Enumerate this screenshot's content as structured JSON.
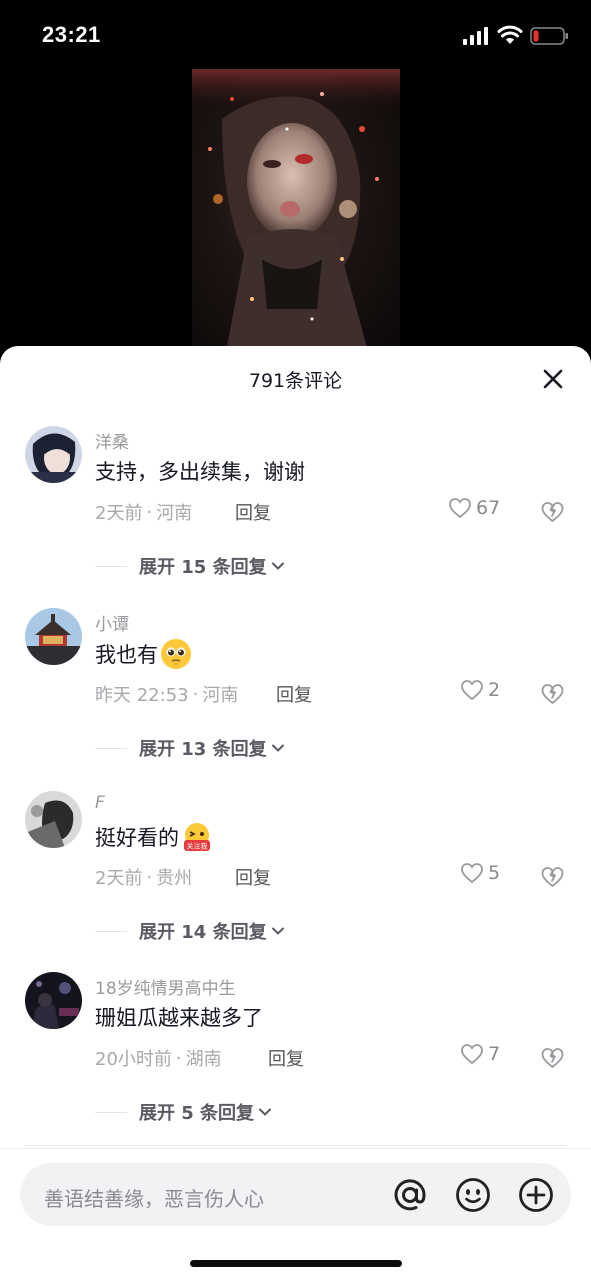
{
  "status_bar": {
    "time": "23:21",
    "battery_color": "#e5332a"
  },
  "sheet": {
    "title": "791条评论"
  },
  "comments": [
    {
      "username": "洋桑",
      "text": "支持，多出续集，谢谢",
      "emoji": "",
      "time": "2天前",
      "location": "河南",
      "reply_label": "回复",
      "likes": "67",
      "expand_label": "展开 15 条回复"
    },
    {
      "username": "小谭",
      "text": "我也有",
      "emoji": "pleading-face",
      "time": "昨天 22:53",
      "location": "河南",
      "reply_label": "回复",
      "likes": "2",
      "expand_label": "展开 13 条回复"
    },
    {
      "username": "F",
      "text": "挺好看的",
      "emoji": "follow-me-sticker",
      "time": "2天前",
      "location": "贵州",
      "reply_label": "回复",
      "likes": "5",
      "expand_label": "展开 14 条回复"
    },
    {
      "username": "18岁纯情男高中生",
      "text": "珊姐瓜越来越多了",
      "emoji": "",
      "time": "20小时前",
      "location": "湖南",
      "reply_label": "回复",
      "likes": "7",
      "expand_label": "展开 5 条回复"
    }
  ],
  "emoji_sticker_text": "关注我",
  "input": {
    "placeholder": "善语结善缘，恶言伤人心"
  },
  "separator": "·"
}
